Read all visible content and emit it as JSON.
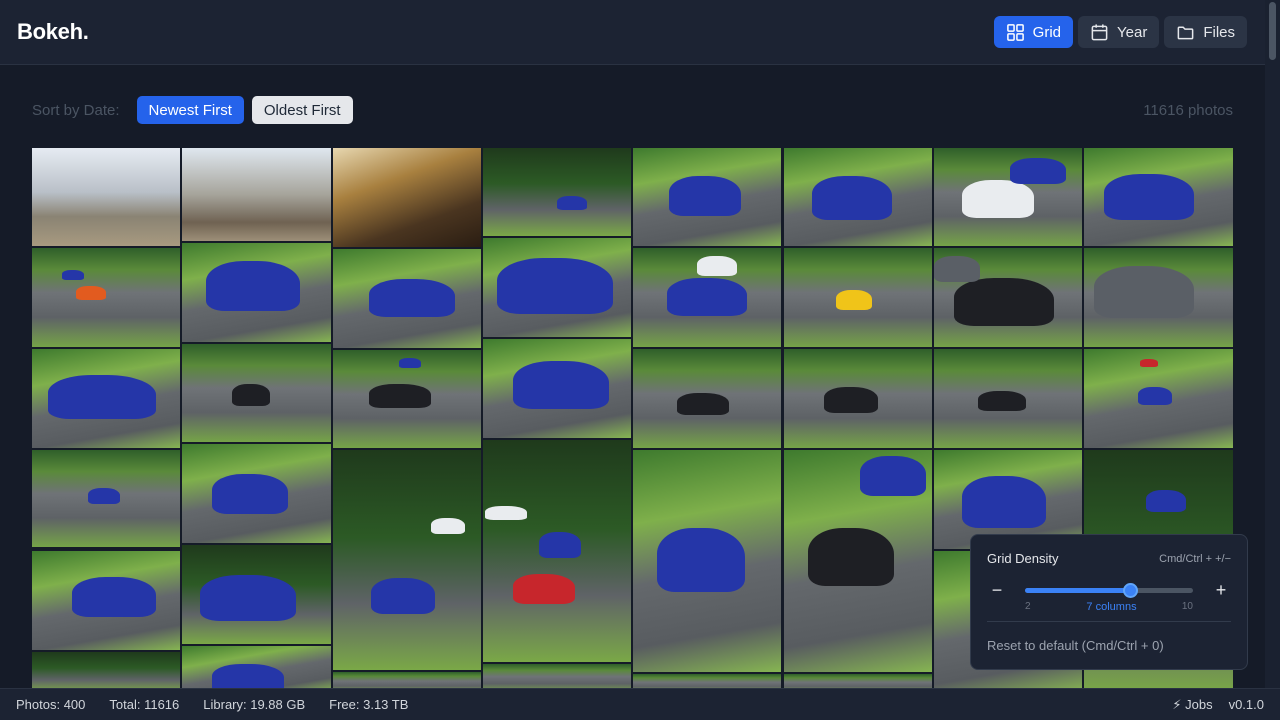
{
  "app": {
    "logo": "Bokeh."
  },
  "header": {
    "views": [
      {
        "label": "Grid",
        "icon": "grid-icon",
        "active": true
      },
      {
        "label": "Year",
        "icon": "calendar-icon",
        "active": false
      },
      {
        "label": "Files",
        "icon": "folder-icon",
        "active": false
      }
    ]
  },
  "sort": {
    "label": "Sort by Date:",
    "newest": "Newest First",
    "oldest": "Oldest First",
    "active": "newest",
    "count": "11616 photos"
  },
  "density": {
    "title": "Grid Density",
    "shortcut": "Cmd/Ctrl + +/−",
    "minus": "−",
    "plus": "+",
    "min": "2",
    "max": "10",
    "value": 7,
    "current_label": "7 columns",
    "reset": "Reset to default (Cmd/Ctrl + 0)"
  },
  "status": {
    "photos": "Photos: 400",
    "total": "Total: 11616",
    "library": "Library: 19.88 GB",
    "free": "Free: 3.13 TB",
    "jobs": "⚡ Jobs",
    "version": "v0.1.0"
  },
  "colors": {
    "accent": "#2563eb",
    "background": "#151b28",
    "panel": "#1c2333"
  }
}
